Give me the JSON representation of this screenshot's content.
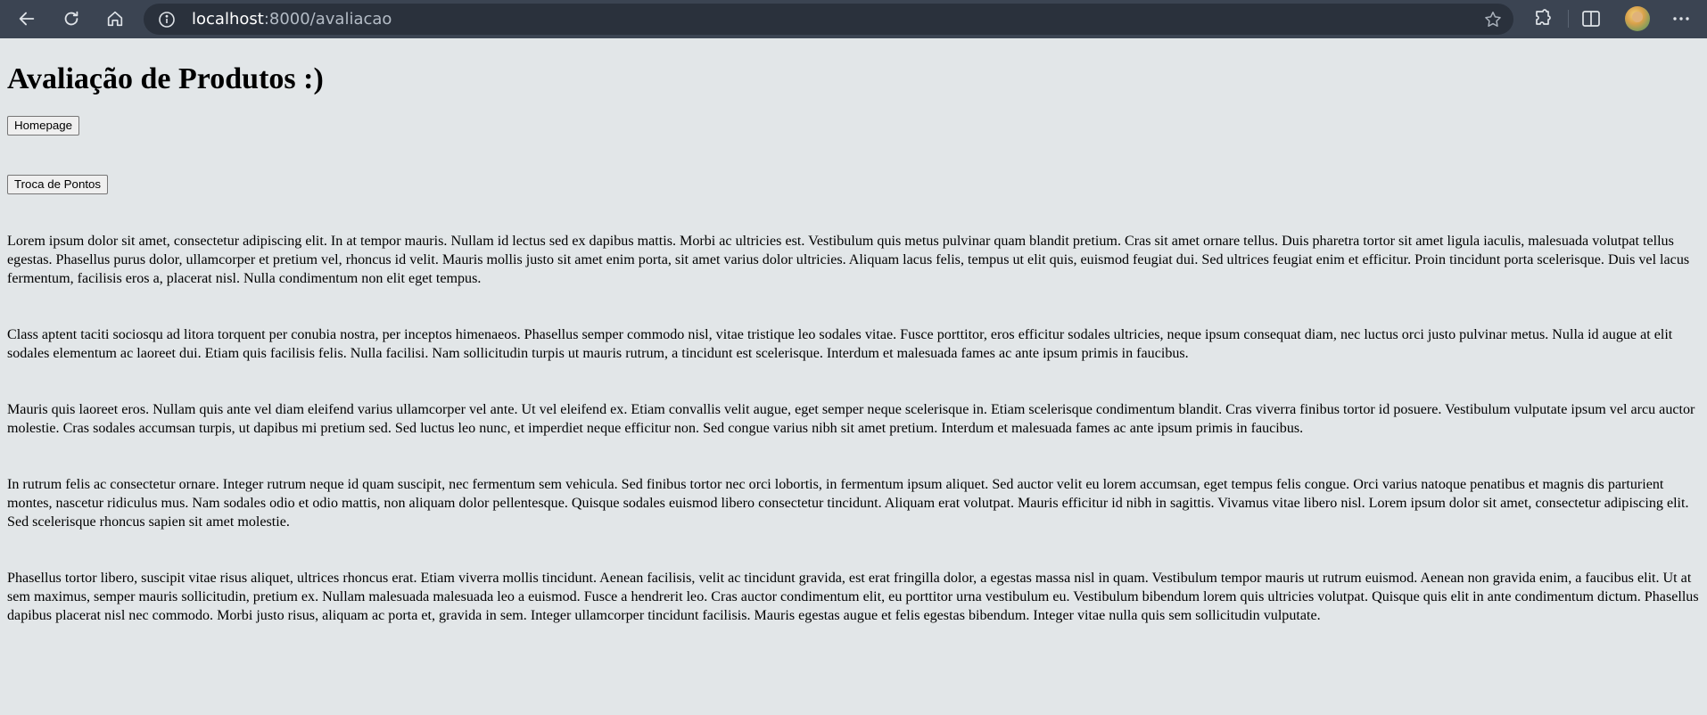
{
  "browser": {
    "url_host": "localhost",
    "url_path": ":8000/avaliacao"
  },
  "page": {
    "title": "Avaliação de Produtos :)",
    "homepage_label": "Homepage",
    "troca_label": "Troca de Pontos",
    "paragraphs": [
      "Lorem ipsum dolor sit amet, consectetur adipiscing elit. In at tempor mauris. Nullam id lectus sed ex dapibus mattis. Morbi ac ultricies est. Vestibulum quis metus pulvinar quam blandit pretium. Cras sit amet ornare tellus. Duis pharetra tortor sit amet ligula iaculis, malesuada volutpat tellus egestas. Phasellus purus dolor, ullamcorper et pretium vel, rhoncus id velit. Mauris mollis justo sit amet enim porta, sit amet varius dolor ultricies. Aliquam lacus felis, tempus ut elit quis, euismod feugiat dui. Sed ultrices feugiat enim et efficitur. Proin tincidunt porta scelerisque. Duis vel lacus fermentum, facilisis eros a, placerat nisl. Nulla condimentum non elit eget tempus.",
      "Class aptent taciti sociosqu ad litora torquent per conubia nostra, per inceptos himenaeos. Phasellus semper commodo nisl, vitae tristique leo sodales vitae. Fusce porttitor, eros efficitur sodales ultricies, neque ipsum consequat diam, nec luctus orci justo pulvinar metus. Nulla id augue at elit sodales elementum ac laoreet dui. Etiam quis facilisis felis. Nulla facilisi. Nam sollicitudin turpis ut mauris rutrum, a tincidunt est scelerisque. Interdum et malesuada fames ac ante ipsum primis in faucibus.",
      "Mauris quis laoreet eros. Nullam quis ante vel diam eleifend varius ullamcorper vel ante. Ut vel eleifend ex. Etiam convallis velit augue, eget semper neque scelerisque in. Etiam scelerisque condimentum blandit. Cras viverra finibus tortor id posuere. Vestibulum vulputate ipsum vel arcu auctor molestie. Cras sodales accumsan turpis, ut dapibus mi pretium sed. Sed luctus leo nunc, et imperdiet neque efficitur non. Sed congue varius nibh sit amet pretium. Interdum et malesuada fames ac ante ipsum primis in faucibus.",
      "In rutrum felis ac consectetur ornare. Integer rutrum neque id quam suscipit, nec fermentum sem vehicula. Sed finibus tortor nec orci lobortis, in fermentum ipsum aliquet. Sed auctor velit eu lorem accumsan, eget tempus felis congue. Orci varius natoque penatibus et magnis dis parturient montes, nascetur ridiculus mus. Nam sodales odio et odio mattis, non aliquam dolor pellentesque. Quisque sodales euismod libero consectetur tincidunt. Aliquam erat volutpat. Mauris efficitur id nibh in sagittis. Vivamus vitae libero nisl. Lorem ipsum dolor sit amet, consectetur adipiscing elit. Sed scelerisque rhoncus sapien sit amet molestie.",
      "Phasellus tortor libero, suscipit vitae risus aliquet, ultrices rhoncus erat. Etiam viverra mollis tincidunt. Aenean facilisis, velit ac tincidunt gravida, est erat fringilla dolor, a egestas massa nisl in quam. Vestibulum tempor mauris ut rutrum euismod. Aenean non gravida enim, a faucibus elit. Ut at sem maximus, semper mauris sollicitudin, pretium ex. Nullam malesuada malesuada leo a euismod. Fusce a hendrerit leo. Cras auctor condimentum elit, eu porttitor urna vestibulum eu. Vestibulum bibendum lorem quis ultricies volutpat. Quisque quis elit in ante condimentum dictum. Phasellus dapibus placerat nisl nec commodo. Morbi justo risus, aliquam ac porta et, gravida in sem. Integer ullamcorper tincidunt facilisis. Mauris egestas augue et felis egestas bibendum. Integer vitae nulla quis sem sollicitudin vulputate."
    ]
  },
  "colors": {
    "page_background": "#e2e6e8",
    "toolbar_background": "#3b4452",
    "address_bar_background": "#2a313c"
  },
  "icons": {
    "back": "back-arrow-icon",
    "reload": "reload-icon",
    "home": "home-icon",
    "site_info": "info-icon",
    "favorite": "star-icon",
    "extensions": "puzzle-icon",
    "split_screen": "split-screen-icon",
    "profile": "avatar",
    "menu": "more-icon"
  }
}
